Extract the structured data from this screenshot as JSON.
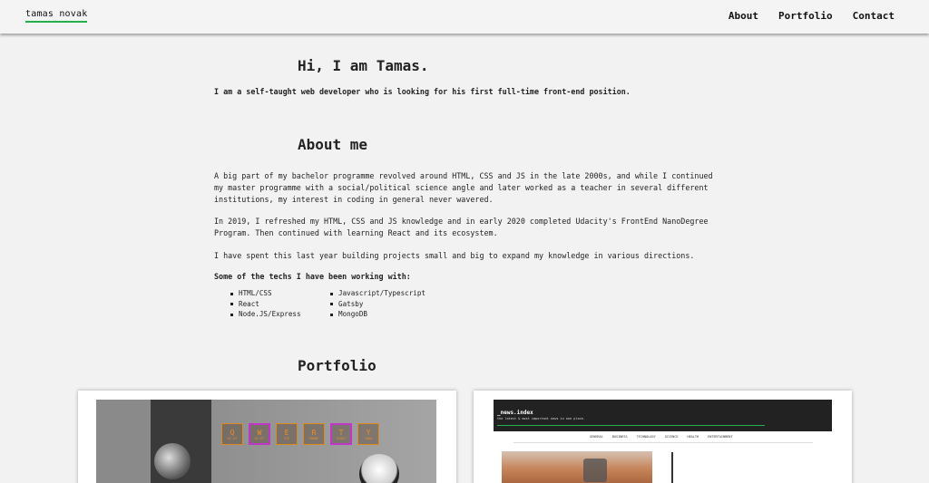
{
  "nav": {
    "brand": "tamas novak",
    "links": [
      "About",
      "Portfolio",
      "Contact"
    ],
    "accent_color": "#22b14c"
  },
  "hero": {
    "heading": "Hi, I am Tamas.",
    "intro": "I am a self-taught web developer who is looking for his first full-time front-end position."
  },
  "about": {
    "heading": "About me",
    "paragraphs": [
      "A big part of my bachelor programme revolved around HTML, CSS and JS in the late 2000s, and while I continued my master programme with a social/political science angle and later worked as a teacher in several different institutions, my interest in coding in general never wavered.",
      "In 2019, I refreshed my HTML, CSS and JS knowledge and in early 2020 completed Udacity's FrontEnd NanoDegree Program. Then continued with learning React and its ecosystem.",
      "I have spent this last year building projects small and big to expand my knowledge in various directions."
    ],
    "techs_heading": "Some of the techs I have been working with:",
    "techs": [
      "HTML/CSS",
      "Javascript/Typescript",
      "React",
      "Gatsby",
      "Node.JS/Express",
      "MongoDB"
    ]
  },
  "portfolio": {
    "heading": "Portfolio",
    "project1": {
      "keys": [
        {
          "k": "Q",
          "s": "AT-AT",
          "hl": false
        },
        {
          "k": "W",
          "s": "AT-ST",
          "hl": true
        },
        {
          "k": "E",
          "s": "TIE",
          "hl": false
        },
        {
          "k": "R",
          "s": "PROBE",
          "hl": false
        },
        {
          "k": "T",
          "s": "SCOUT",
          "hl": true
        },
        {
          "k": "Y",
          "s": "YODA",
          "hl": false
        }
      ],
      "key_color": "#e08a1e",
      "highlight_color": "#c235c9"
    },
    "project2": {
      "title": "_news.index",
      "subtitle": "the latest & most important news in one place.",
      "menu": [
        "GENERAL",
        "BUSINESS",
        "TECHNOLOGY",
        "SCIENCE",
        "HEALTH",
        "ENTERTAINMENT"
      ]
    }
  }
}
